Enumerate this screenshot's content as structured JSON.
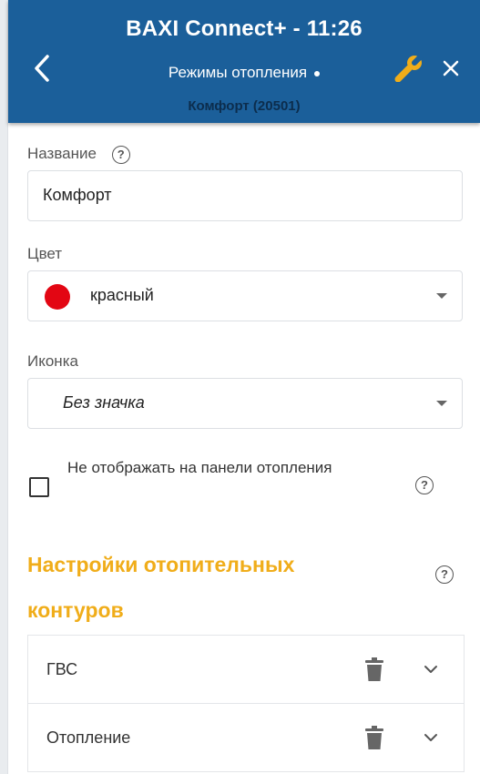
{
  "header": {
    "title": "BAXI Connect+ - 11:26",
    "subtitle": "Режимы отопления",
    "breadcrumb": "Комфорт (20501)",
    "bg_color": "#1b5f9a",
    "icons": [
      "back-arrow-icon",
      "wrench-icon",
      "close-icon"
    ]
  },
  "form": {
    "name_label": "Название",
    "name_value": "Комфорт",
    "color_label": "Цвет",
    "color_value": "красный",
    "color_swatch": "#e30613",
    "icon_label": "Иконка",
    "icon_value": "Без значка",
    "hide_checkbox_label": "Не отображать на панели отопления",
    "hide_checkbox_checked": false,
    "help_glyph": "?"
  },
  "circuits": {
    "title": "Настройки отопительных контуров",
    "accent_color": "#f0ad1a",
    "items": [
      {
        "label": "ГВС"
      },
      {
        "label": "Отопление"
      }
    ]
  }
}
